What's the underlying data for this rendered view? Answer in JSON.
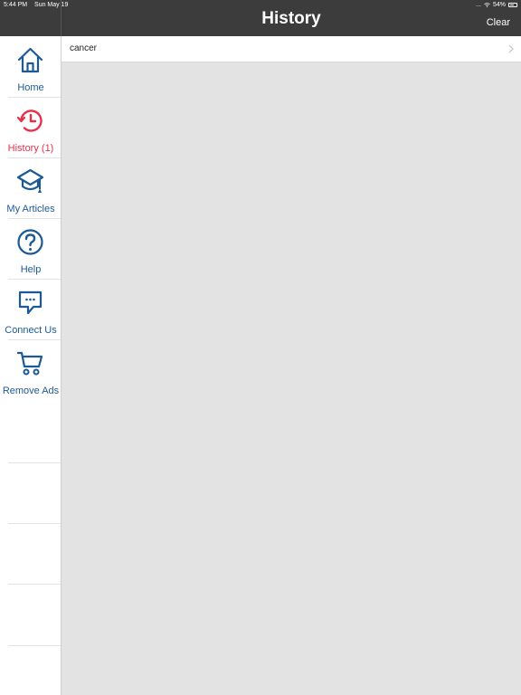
{
  "status_bar": {
    "time": "5:44 PM",
    "date": "Sun May 19",
    "signal": "...",
    "battery": "54%"
  },
  "header": {
    "title": "History",
    "clear_label": "Clear"
  },
  "sidebar": {
    "items": [
      {
        "label": "Home",
        "icon": "home-icon"
      },
      {
        "label": "History (1)",
        "icon": "history-icon",
        "active": true
      },
      {
        "label": "My Articles",
        "icon": "graduation-cap-icon"
      },
      {
        "label": "Help",
        "icon": "help-icon"
      },
      {
        "label": "Connect Us",
        "icon": "chat-bubble-icon"
      },
      {
        "label": "Remove Ads",
        "icon": "cart-icon"
      }
    ]
  },
  "history": {
    "items": [
      {
        "term": "cancer"
      }
    ]
  },
  "colors": {
    "header_bg": "#3c3c3c",
    "nav_blue": "#1d5a94",
    "active_red": "#e5314a",
    "content_bg": "#e3e3e3"
  }
}
